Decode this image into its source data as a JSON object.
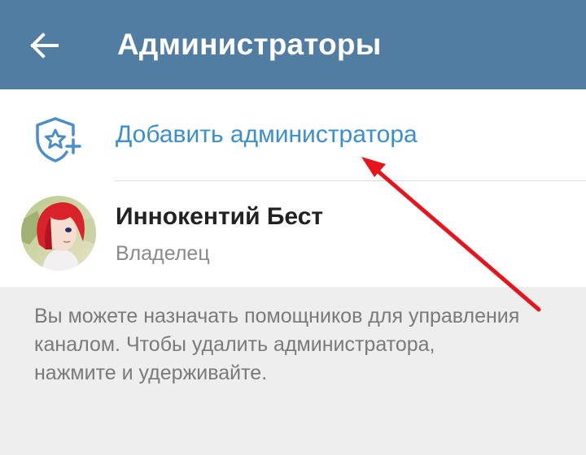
{
  "header": {
    "title": "Администраторы",
    "back_icon": "arrow-left-icon"
  },
  "actions": {
    "add_admin_label": "Добавить администратора",
    "add_admin_icon": "shield-star-plus-icon"
  },
  "admins": [
    {
      "name": "Иннокентий Бест",
      "role": "Владелец"
    }
  ],
  "hint": "Вы можете назначать помощников для управления каналом. Чтобы удалить администратора, нажмите и удерживайте.",
  "colors": {
    "header_bg": "#517da2",
    "accent": "#3a8fd0",
    "annotation_arrow": "#e8141c"
  }
}
